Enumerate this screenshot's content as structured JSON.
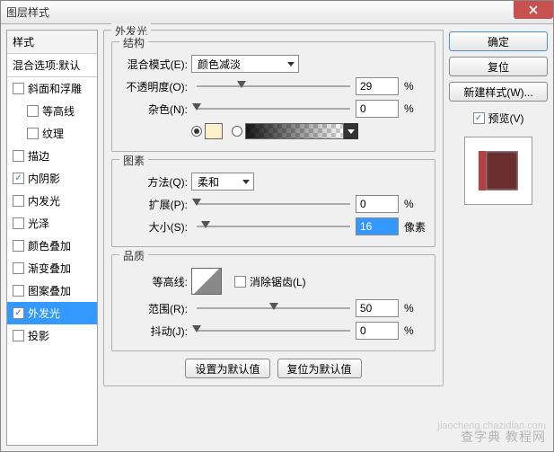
{
  "window": {
    "title": "图层样式"
  },
  "sidebar": {
    "header": "样式",
    "sub": "混合选项:默认",
    "items": [
      {
        "label": "斜面和浮雕",
        "checked": false,
        "indent": false
      },
      {
        "label": "等高线",
        "checked": false,
        "indent": true
      },
      {
        "label": "纹理",
        "checked": false,
        "indent": true
      },
      {
        "label": "描边",
        "checked": false,
        "indent": false
      },
      {
        "label": "内阴影",
        "checked": true,
        "indent": false
      },
      {
        "label": "内发光",
        "checked": false,
        "indent": false
      },
      {
        "label": "光泽",
        "checked": false,
        "indent": false
      },
      {
        "label": "颜色叠加",
        "checked": false,
        "indent": false
      },
      {
        "label": "渐变叠加",
        "checked": false,
        "indent": false
      },
      {
        "label": "图案叠加",
        "checked": false,
        "indent": false
      },
      {
        "label": "外发光",
        "checked": true,
        "indent": false,
        "selected": true
      },
      {
        "label": "投影",
        "checked": false,
        "indent": false
      }
    ]
  },
  "main": {
    "title": "外发光",
    "structure": {
      "legend": "结构",
      "blend_label": "混合模式(E):",
      "blend_value": "颜色减淡",
      "opacity_label": "不透明度(O):",
      "opacity_value": "29",
      "opacity_unit": "%",
      "noise_label": "杂色(N):",
      "noise_value": "0",
      "noise_unit": "%"
    },
    "elements": {
      "legend": "图素",
      "method_label": "方法(Q):",
      "method_value": "柔和",
      "spread_label": "扩展(P):",
      "spread_value": "0",
      "spread_unit": "%",
      "size_label": "大小(S):",
      "size_value": "16",
      "size_unit": "像素"
    },
    "quality": {
      "legend": "品质",
      "contour_label": "等高线:",
      "antialias_label": "消除锯齿(L)",
      "range_label": "范围(R):",
      "range_value": "50",
      "range_unit": "%",
      "jitter_label": "抖动(J):",
      "jitter_value": "0",
      "jitter_unit": "%"
    },
    "buttons": {
      "reset_default": "设置为默认值",
      "revert_default": "复位为默认值"
    }
  },
  "right": {
    "ok": "确定",
    "cancel": "复位",
    "new_style": "新建样式(W)...",
    "preview": "预览(V)"
  },
  "watermark": "查字典 教程网",
  "watermark2": "jiaocheng.chazidian.com"
}
